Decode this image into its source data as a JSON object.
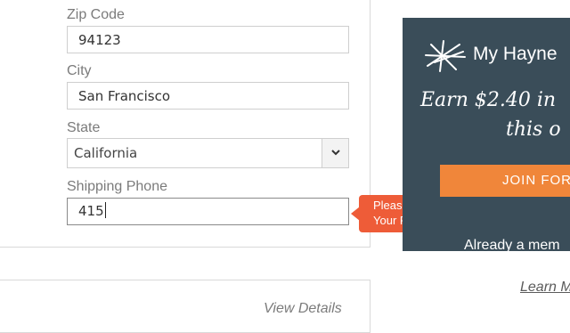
{
  "form": {
    "zip": {
      "label": "Zip Code",
      "value": "94123"
    },
    "city": {
      "label": "City",
      "value": "San Francisco"
    },
    "state": {
      "label": "State",
      "value": "California"
    },
    "phone": {
      "label": "Shipping Phone",
      "value": "415"
    }
  },
  "tooltip": {
    "line1": "Please Enter",
    "line2": "Your Full Phone Number"
  },
  "lower": {
    "view_details": "View Details"
  },
  "promo": {
    "brand": "My Hayne",
    "headline_line1": "Earn $2.40 in",
    "headline_line2": "this o",
    "join_label": "JOIN FOR",
    "member_text": "Already a mem",
    "learn_more": "Learn M"
  },
  "colors": {
    "tooltip": "#ee5c38",
    "promo_bg": "#3a4d59",
    "join_button": "#f0863a"
  }
}
